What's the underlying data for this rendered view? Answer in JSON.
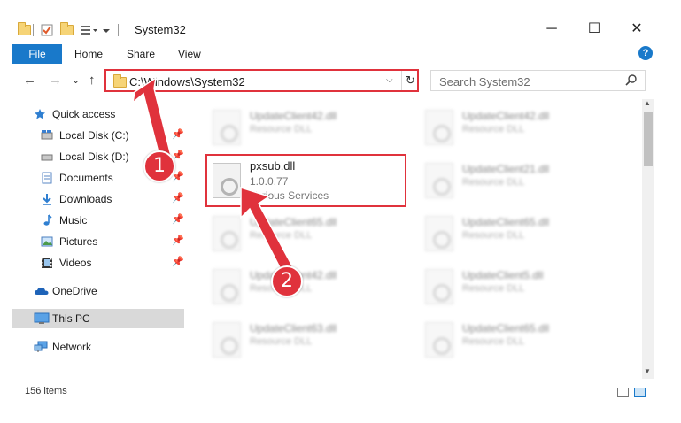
{
  "window": {
    "title": "System32",
    "minimize_glyph": "─",
    "maximize_glyph": "☐",
    "close_glyph": "✕"
  },
  "ribbon": {
    "tabs": [
      "File",
      "Home",
      "Share",
      "View"
    ],
    "expand_glyph": "⌄",
    "help_glyph": "?"
  },
  "address": {
    "path": "C:\\Windows\\System32",
    "back_glyph": "←",
    "forward_glyph": "→",
    "recent_glyph": "⌄",
    "up_glyph": "↑",
    "dropdown_glyph": "⌵",
    "refresh_glyph": "↻"
  },
  "search": {
    "placeholder": "Search System32",
    "icon": "search-icon"
  },
  "navigation": {
    "items": [
      {
        "label": "Quick access",
        "icon": "star-icon",
        "pinned": false
      },
      {
        "label": "Local Disk (C:)",
        "icon": "drive-icon",
        "pinned": true
      },
      {
        "label": "Local Disk (D:)",
        "icon": "drive-icon",
        "pinned": true
      },
      {
        "label": "Documents",
        "icon": "documents-icon",
        "pinned": true
      },
      {
        "label": "Downloads",
        "icon": "download-icon",
        "pinned": true
      },
      {
        "label": "Music",
        "icon": "music-icon",
        "pinned": true
      },
      {
        "label": "Pictures",
        "icon": "pictures-icon",
        "pinned": true
      },
      {
        "label": "Videos",
        "icon": "videos-icon",
        "pinned": true
      },
      {
        "label": "OneDrive",
        "icon": "cloud-icon",
        "pinned": false
      },
      {
        "label": "This PC",
        "icon": "computer-icon",
        "pinned": false
      },
      {
        "label": "Network",
        "icon": "network-icon",
        "pinned": false
      }
    ],
    "pin_glyph": "📌"
  },
  "files": {
    "background": [
      {
        "name": "UpdateClient42.dll",
        "desc": "Resource DLL"
      },
      {
        "name": "UpdateClient42.dll",
        "desc": "Resource DLL"
      },
      {
        "name": "UpdateClient21.dll",
        "desc": "Resource DLL"
      },
      {
        "name": "UpdateClient65.dll",
        "desc": "Resource DLL"
      },
      {
        "name": "UpdateClient65.dll",
        "desc": "Resource DLL"
      },
      {
        "name": "UpdateClient42.dll",
        "desc": "Resource DLL"
      },
      {
        "name": "UpdateClient5.dll",
        "desc": "Resource DLL"
      },
      {
        "name": "UpdateClient63.dll",
        "desc": "Resource DLL"
      },
      {
        "name": "UpdateClient65.dll",
        "desc": "Resource DLL"
      }
    ],
    "highlighted": {
      "name": "pxsub.dll",
      "version": "1.0.0.77",
      "company": "Various Services"
    }
  },
  "status": {
    "item_count": "156 items"
  },
  "annotations": {
    "badge_1": "1",
    "badge_2": "2",
    "color": "#e0323c"
  },
  "colors": {
    "accent": "#1979ca",
    "highlight_border": "#e0323c",
    "selection": "#d9d9d9"
  }
}
